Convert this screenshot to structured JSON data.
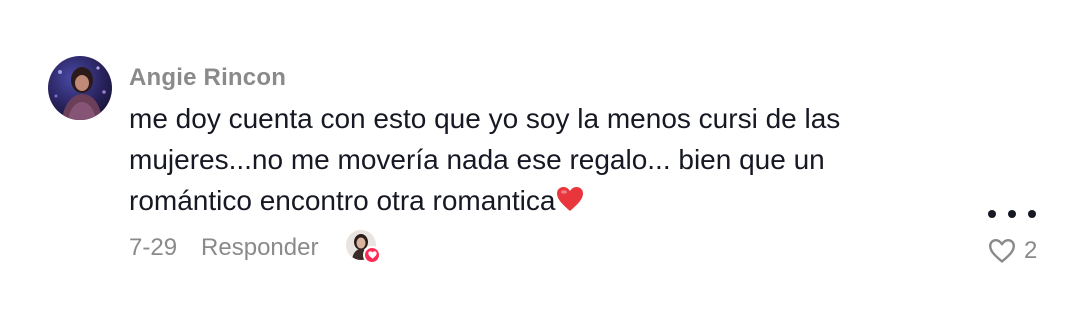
{
  "comment": {
    "username": "Angie Rincon",
    "text_lines": [
      "me doy cuenta con esto que yo soy la menos cursi de las",
      "mujeres...no me movería nada ese regalo... bien que un",
      "romántico encontro otra romantica"
    ],
    "trailing_emoji": "red-heart-emoji",
    "date": "7-29",
    "reply_label": "Responder",
    "like_count": "2",
    "liked_by_creator": true,
    "more_icon": "more-horizontal-icon",
    "like_icon": "heart-outline-icon",
    "colors": {
      "username": "#8a8a8a",
      "text": "#161823",
      "meta": "#8a8a8a",
      "creator_heart": "#fe2c55",
      "emoji_heart": "#e8363c"
    }
  }
}
